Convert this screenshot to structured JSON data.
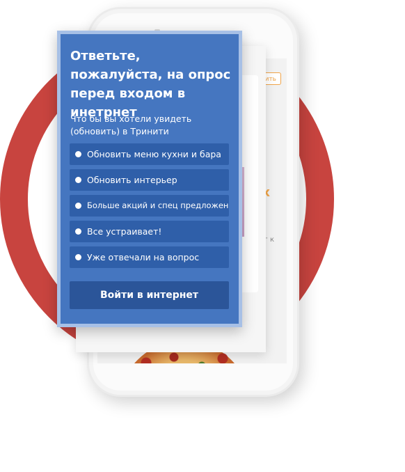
{
  "survey": {
    "title": "Ответьте, пожалуйста, на опрос перед входом в инетрнет",
    "question": "Что бы вы хотели увидеть (обновить) в Тринити",
    "options": [
      "Обновить меню кухни и бара",
      "Обновить интерьер",
      "Больше акций и спец предложений",
      "Все устраивает!",
      "Уже отвечали на вопрос"
    ],
    "submit_label": "Войти в интернет"
  },
  "background_screen": {
    "button_fragment": "ить",
    "x_fragment": "х",
    "text_fragment": "г к"
  },
  "colors": {
    "ring": "#c8443f",
    "popup": "#4576c0",
    "option_bg": "#2f5fa9",
    "submit_bg": "#2b5599",
    "accent_orange": "#f0a449"
  }
}
